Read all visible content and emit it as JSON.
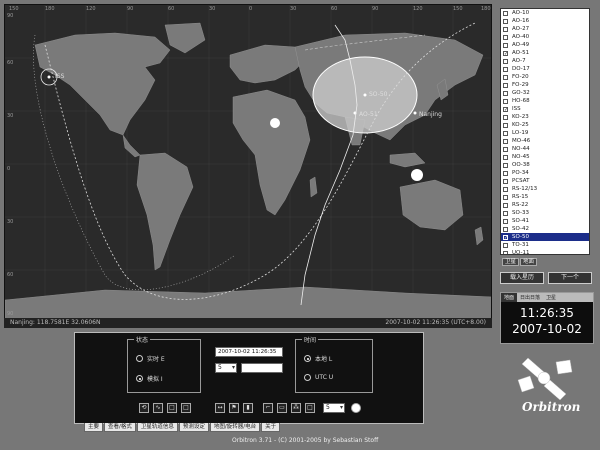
{
  "map": {
    "satellites": [
      {
        "label": "ISS"
      },
      {
        "label": "SO-50"
      },
      {
        "label": "AO-51"
      },
      {
        "label": "Nanjing"
      }
    ],
    "lon_labels": [
      "150",
      "180",
      "120",
      "90",
      "60",
      "30",
      "0",
      "30",
      "60",
      "90",
      "120",
      "150",
      "180"
    ],
    "lat_labels": [
      "90",
      "60",
      "30",
      "0",
      "30",
      "60",
      "90"
    ],
    "status_left": "Nanjing: 118.7581E 32.0606N",
    "status_right": "2007-10-02 11:26:35 (UTC+8.00)"
  },
  "satellite_list": {
    "items": [
      {
        "label": "AO-10",
        "checked": false
      },
      {
        "label": "AO-16",
        "checked": false
      },
      {
        "label": "AO-27",
        "checked": false
      },
      {
        "label": "AO-40",
        "checked": false
      },
      {
        "label": "AO-49",
        "checked": false
      },
      {
        "label": "AO-51",
        "checked": true
      },
      {
        "label": "AO-7",
        "checked": false
      },
      {
        "label": "DO-17",
        "checked": false
      },
      {
        "label": "FO-20",
        "checked": false
      },
      {
        "label": "FO-29",
        "checked": false
      },
      {
        "label": "GO-32",
        "checked": false
      },
      {
        "label": "HO-68",
        "checked": false
      },
      {
        "label": "ISS",
        "checked": true
      },
      {
        "label": "KO-23",
        "checked": false
      },
      {
        "label": "KO-25",
        "checked": false
      },
      {
        "label": "LO-19",
        "checked": false
      },
      {
        "label": "MO-46",
        "checked": false
      },
      {
        "label": "NO-44",
        "checked": false
      },
      {
        "label": "NO-45",
        "checked": false
      },
      {
        "label": "OO-38",
        "checked": false
      },
      {
        "label": "PO-34",
        "checked": false
      },
      {
        "label": "PCSAT",
        "checked": false
      },
      {
        "label": "RS-12/13",
        "checked": false
      },
      {
        "label": "RS-15",
        "checked": false
      },
      {
        "label": "RS-22",
        "checked": false
      },
      {
        "label": "SO-33",
        "checked": false
      },
      {
        "label": "SO-41",
        "checked": false
      },
      {
        "label": "SO-42",
        "checked": false
      },
      {
        "label": "SO-50",
        "checked": true,
        "selected": true
      },
      {
        "label": "TO-31",
        "checked": false
      },
      {
        "label": "UO-11",
        "checked": false
      },
      {
        "label": "UO-22",
        "checked": false
      }
    ],
    "tab_a": "卫星",
    "tab_b": "地面",
    "load_button": "载入星历",
    "next_button": "下一个"
  },
  "clock": {
    "tab_1": "地面",
    "tab_2": "日出日落",
    "tab_3": "卫星",
    "time": "11:26:35",
    "date": "2007-10-02"
  },
  "logo": {
    "text": "Orbitron"
  },
  "control_panel": {
    "state_group": "状态",
    "radio_realtime": "实时 E",
    "radio_sim": "模拟 I",
    "sim_datetime": "2007-10-02 11:26:35",
    "step_value": "5",
    "time_group": "时间",
    "radio_local": "本地 L",
    "radio_utc": "UTC U",
    "zoom_value": "5"
  },
  "tabs": [
    "主要",
    "查看/格式",
    "卫星轨道信息",
    "预测设定",
    "地图/旋转器/电台",
    "关于"
  ],
  "footer": "Orbitron 3.71 - (C) 2001-2005 by Sebastian Stoff",
  "colors": {
    "land": "#777777",
    "ocean": "#2a2a2a",
    "selected": "#1c2e8a"
  }
}
